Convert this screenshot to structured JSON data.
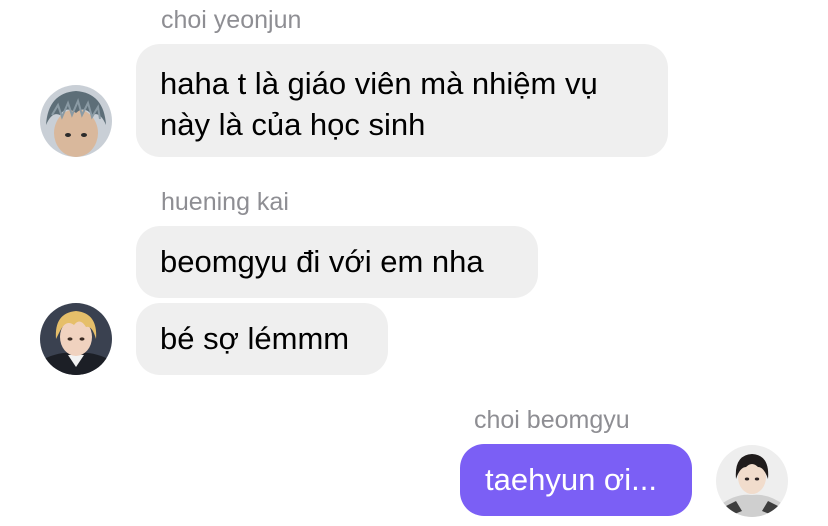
{
  "messages": [
    {
      "sender": "choi yeonjun",
      "lines": [
        "haha t là giáo viên mà nhiệm vụ",
        "này là của học sinh"
      ]
    },
    {
      "sender": "huening kai",
      "text": "beomgyu đi với em nha"
    },
    {
      "text": "bé sợ lémmm"
    },
    {
      "sender": "choi beomgyu",
      "text": "taehyun ơi..."
    }
  ],
  "colors": {
    "incoming_bubble": "#efefef",
    "outgoing_bubble": "#7b5ff5",
    "sender_name": "#8e8e93"
  }
}
